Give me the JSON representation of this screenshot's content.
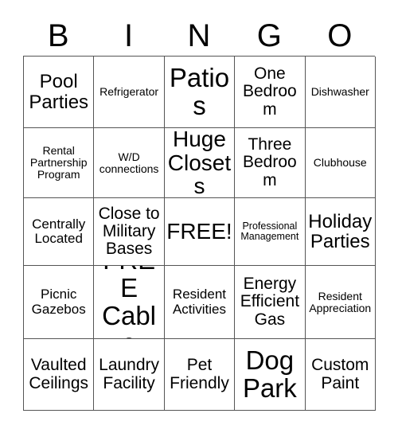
{
  "card": {
    "header_letters": [
      "B",
      "I",
      "N",
      "G",
      "O"
    ],
    "rows": [
      [
        {
          "text": "Pool Parties",
          "size": "fs-lg"
        },
        {
          "text": "Refrigerator",
          "size": "fs-xs"
        },
        {
          "text": "Patios",
          "size": "fs-xxl"
        },
        {
          "text": "One Bedroom",
          "size": "fs-md"
        },
        {
          "text": "Dishwasher",
          "size": "fs-xs"
        }
      ],
      [
        {
          "text": "Rental Partnership Program",
          "size": "fs-xs"
        },
        {
          "text": "W/D connections",
          "size": "fs-xs"
        },
        {
          "text": "Huge Closets",
          "size": "fs-xl"
        },
        {
          "text": "Three Bedroom",
          "size": "fs-md"
        },
        {
          "text": "Clubhouse",
          "size": "fs-xs"
        }
      ],
      [
        {
          "text": "Centrally Located",
          "size": "fs-sm"
        },
        {
          "text": "Close to Military Bases",
          "size": "fs-md"
        },
        {
          "text": "FREE!",
          "size": "fs-xl"
        },
        {
          "text": "Professional Management",
          "size": "fs-xxs"
        },
        {
          "text": "Holiday Parties",
          "size": "fs-lg"
        }
      ],
      [
        {
          "text": "Picnic Gazebos",
          "size": "fs-sm"
        },
        {
          "text": "FREE Cable",
          "size": "fs-xxl"
        },
        {
          "text": "Resident Activities",
          "size": "fs-sm"
        },
        {
          "text": "Energy Efficient Gas",
          "size": "fs-md"
        },
        {
          "text": "Resident Appreciation",
          "size": "fs-xs"
        }
      ],
      [
        {
          "text": "Vaulted Ceilings",
          "size": "fs-md"
        },
        {
          "text": "Laundry Facility",
          "size": "fs-md"
        },
        {
          "text": "Pet Friendly",
          "size": "fs-md"
        },
        {
          "text": "Dog Park",
          "size": "fs-xxl"
        },
        {
          "text": "Custom Paint",
          "size": "fs-md"
        }
      ]
    ]
  },
  "colors": {
    "background": "#ffffff",
    "text": "#000000",
    "grid_line": "#555555"
  }
}
